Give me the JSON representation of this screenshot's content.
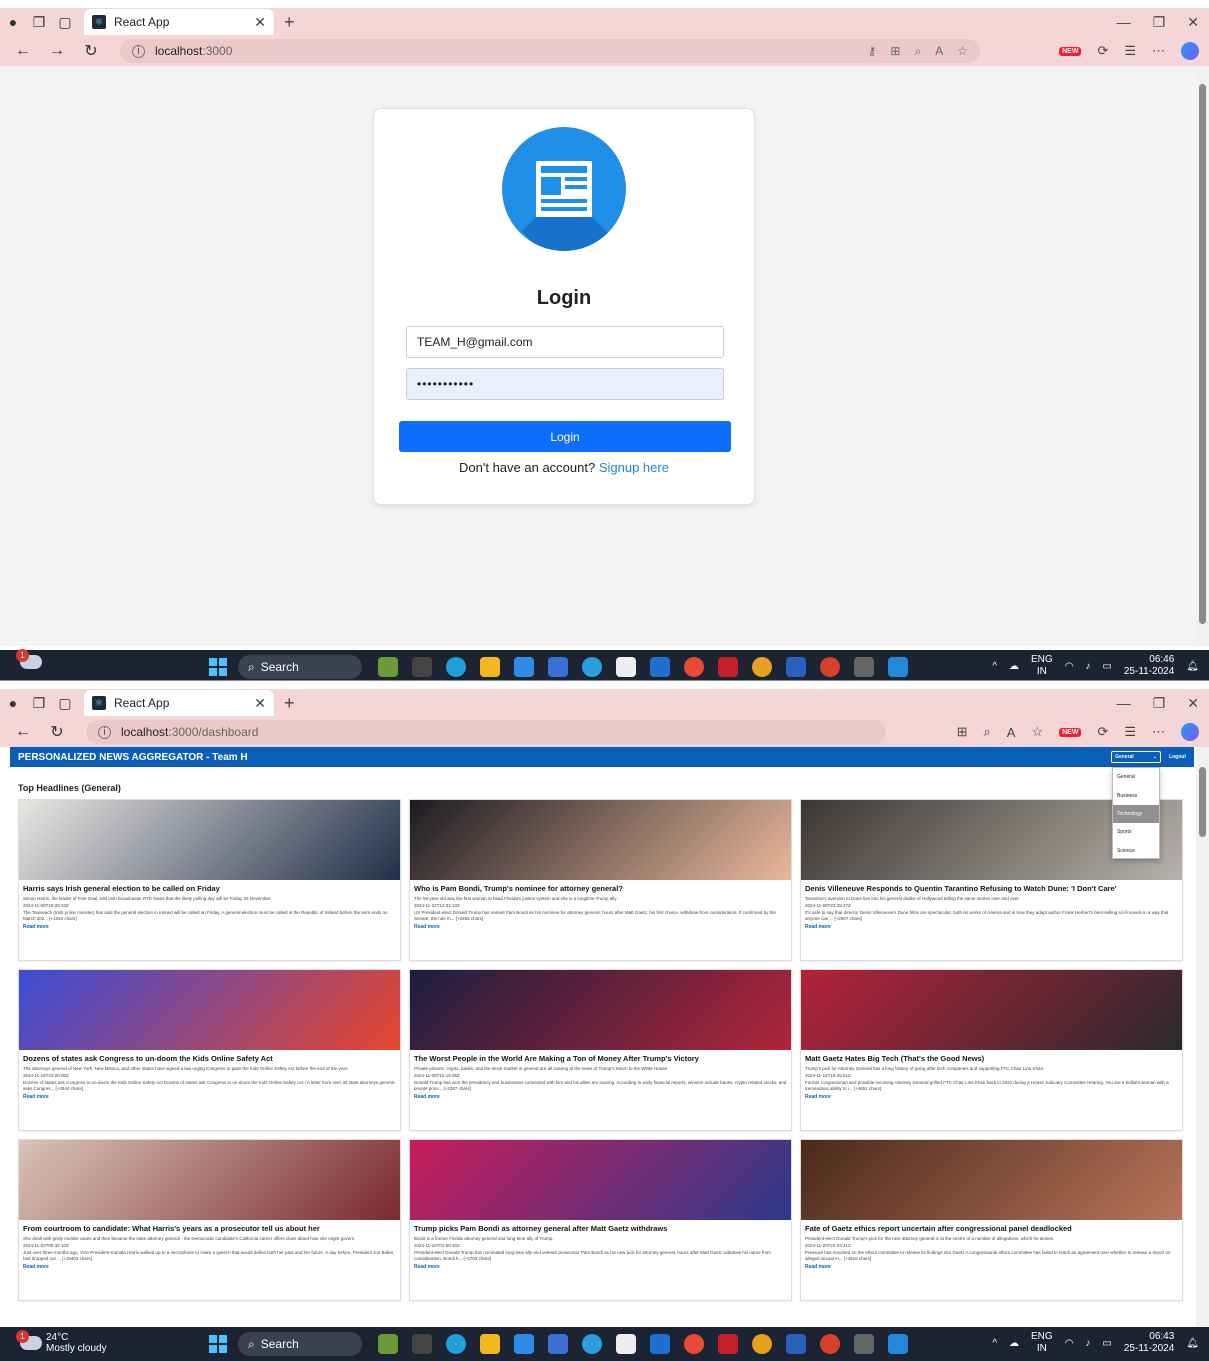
{
  "browser": {
    "tab_title": "React App",
    "login_url_host": "localhost",
    "login_url_port": ":3000",
    "dash_url_host": "localhost",
    "dash_url_path": ":3000/dashboard",
    "new_badge": "NEW"
  },
  "login": {
    "title": "Login",
    "email_value": "TEAM_H@gmail.com",
    "password_mask": "•••••••••••",
    "button_label": "Login",
    "no_account_text": "Don't have an account?",
    "signup_link": "Signup here"
  },
  "taskbar1": {
    "badge": "1",
    "search_label": "Search",
    "lang_top": "ENG",
    "lang_bottom": "IN",
    "time": "06:46",
    "date": "25-11-2024"
  },
  "taskbar2": {
    "badge": "1",
    "temp": "24°C",
    "weather": "Mostly cloudy",
    "search_label": "Search",
    "lang_top": "ENG",
    "lang_bottom": "IN",
    "time": "06:43",
    "date": "25-11-2024"
  },
  "dashboard": {
    "app_title": "PERSONALIZED NEWS AGGREGATOR - Team H",
    "selected_category": "General",
    "logout_label": "Logout",
    "section_title": "Top Headlines (General)",
    "categories": [
      "General",
      "Business",
      "Technology",
      "Sports",
      "Science"
    ],
    "highlighted_category": "Technology",
    "read_more": "Read more",
    "articles": [
      {
        "title": "Harris says Irish general election to be called on Friday",
        "desc": "Simon Harris, the leader of Fine Gael, told Irish broadcaster RTÉ News that the likely polling day will be Friday 29 November.",
        "date": "2024-11-08T19:28:33Z",
        "content": "The Taoiseach (Irish prime minister) has said the general election in Ireland will be called on Friday. A general election must be called in the Republic of Ireland before the term ends on March 202... [+1043 chars]",
        "colors": [
          "#e9e6e2",
          "#22304a"
        ]
      },
      {
        "title": "Who is Pam Bondi, Trump's nominee for attorney general?",
        "desc": "The 59-year-old was the first woman to head Florida's justice system and she is a longtime Trump ally.",
        "date": "2024-11-22T13:34:10Z",
        "content": "US President-elect Donald Trump has named Pam Bondi as his nominee for attorney general, hours after Matt Gaetz, his first choice, withdrew from consideration. If confirmed by the Senate, the role m... [+2482 chars]",
        "colors": [
          "#1c1b22",
          "#e9b89a"
        ]
      },
      {
        "title": "Denis Villeneuve Responds to Quentin Tarantino Refusing to Watch Dune: 'I Don't Care'",
        "desc": "Tarantino's aversion to Dune ties into his general dislike of Hollywood telling the same stories over and over.",
        "date": "2024-11-08T23:25:27Z",
        "content": "It's safe to say that director Denis Villeneuve's Dune films are spectacular, both as works of cinema and in how they adapt author Frank Herbert's best-selling sci-fi novels in a way that anyone can ... [+2607 chars]",
        "colors": [
          "#3b3631",
          "#b7b1ab"
        ]
      },
      {
        "title": "Dozens of states ask Congress to un-doom the Kids Online Safety Act",
        "desc": "The attorneys general of New York, New Mexico, and other states have signed a law urging Congress to pass the Kids Online Safety Act before the end of the year.",
        "date": "2024-11-19T23:00:00Z",
        "content": "Dozens of states ask Congress to un-doom the Kids Online Safety Act Dozens of states ask Congress to un-doom the Kids Online Safety Act / A letter from over 30 state attorneys general asks Congres... [+2544 chars]",
        "colors": [
          "#3a4dd6",
          "#e8452a"
        ]
      },
      {
        "title": "The Worst People in the World Are Making a Ton of Money After Trump's Victory",
        "desc": "Private prisons, crypto, banks, and the stock-market in general are all soaring at the news of Trump's return to the White House.",
        "date": "2024-11-08T15:15:35Z",
        "content": "Donald Trump has won the presidency and businesses connected with him and his allies are soaring. According to early financial reports, winners include banks, crypto-related stocks, and private priso... [+2287 chars]",
        "colors": [
          "#1a1f3d",
          "#b2243a"
        ]
      },
      {
        "title": "Matt Gaetz Hates Big Tech (That's the Good News)",
        "desc": "Trump's pick for Attorney General has a long history of going after tech companies and supporting FTC Chair Lina Khan.",
        "date": "2024-11-14T19:45:51Z",
        "content": "Former congressman and possible incoming Attorney General grilled FTC Chair Lina Khan back in 2023 during a House Judiciary Committee Hearing. You are a brilliant woman with a tremendous ability to i... [+4651 chars]",
        "colors": [
          "#b3223a",
          "#2a2a2e"
        ]
      },
      {
        "title": "From courtroom to candidate: What Harris's years as a prosecutor tell us about her",
        "desc": "She dealt with grisly murder cases and then became the state attorney general - the Democratic candidate's California career offers clues about how she might govern.",
        "date": "2024-11-02T08:32:10Z",
        "content": "Just over three months ago, Vice-President Kamala Harris walked up to a microphone to make a speech that would define both her past and her future. A day before, President Joe Biden had dropped out ... [+15403 chars]",
        "colors": [
          "#d9c3b8",
          "#7a2a2e"
        ]
      },
      {
        "title": "Trump picks Pam Bondi as attorney general after Matt Gaetz withdraws",
        "desc": "Bondi is a former Florida attorney general and long-time ally of Trump.",
        "date": "2024-11-22T01:50:30Z",
        "content": "President-elect Donald Trump has nominated long-time ally and veteran prosecutor Pam Bondi as his new pick for attorney general, hours after Matt Gaetz withdrew his name from consideration. Bondi h... [+2703 chars]",
        "colors": [
          "#c91d5a",
          "#2a3a8a"
        ]
      },
      {
        "title": "Fate of Gaetz ethics report uncertain after congressional panel deadlocked",
        "desc": "President-elect Donald Trump's pick for the next attorney general is at the centre of a number of allegations, which he denies.",
        "date": "2024-11-20T23:23:41Z",
        "content": "Pressure has mounted on the ethics committee to release its findings into Gaetz A congressional ethics committee has failed to reach an agreement over whether to release a report on alleged sexual m... [+4616 chars]",
        "colors": [
          "#4a2a1a",
          "#b8735a"
        ]
      }
    ]
  }
}
